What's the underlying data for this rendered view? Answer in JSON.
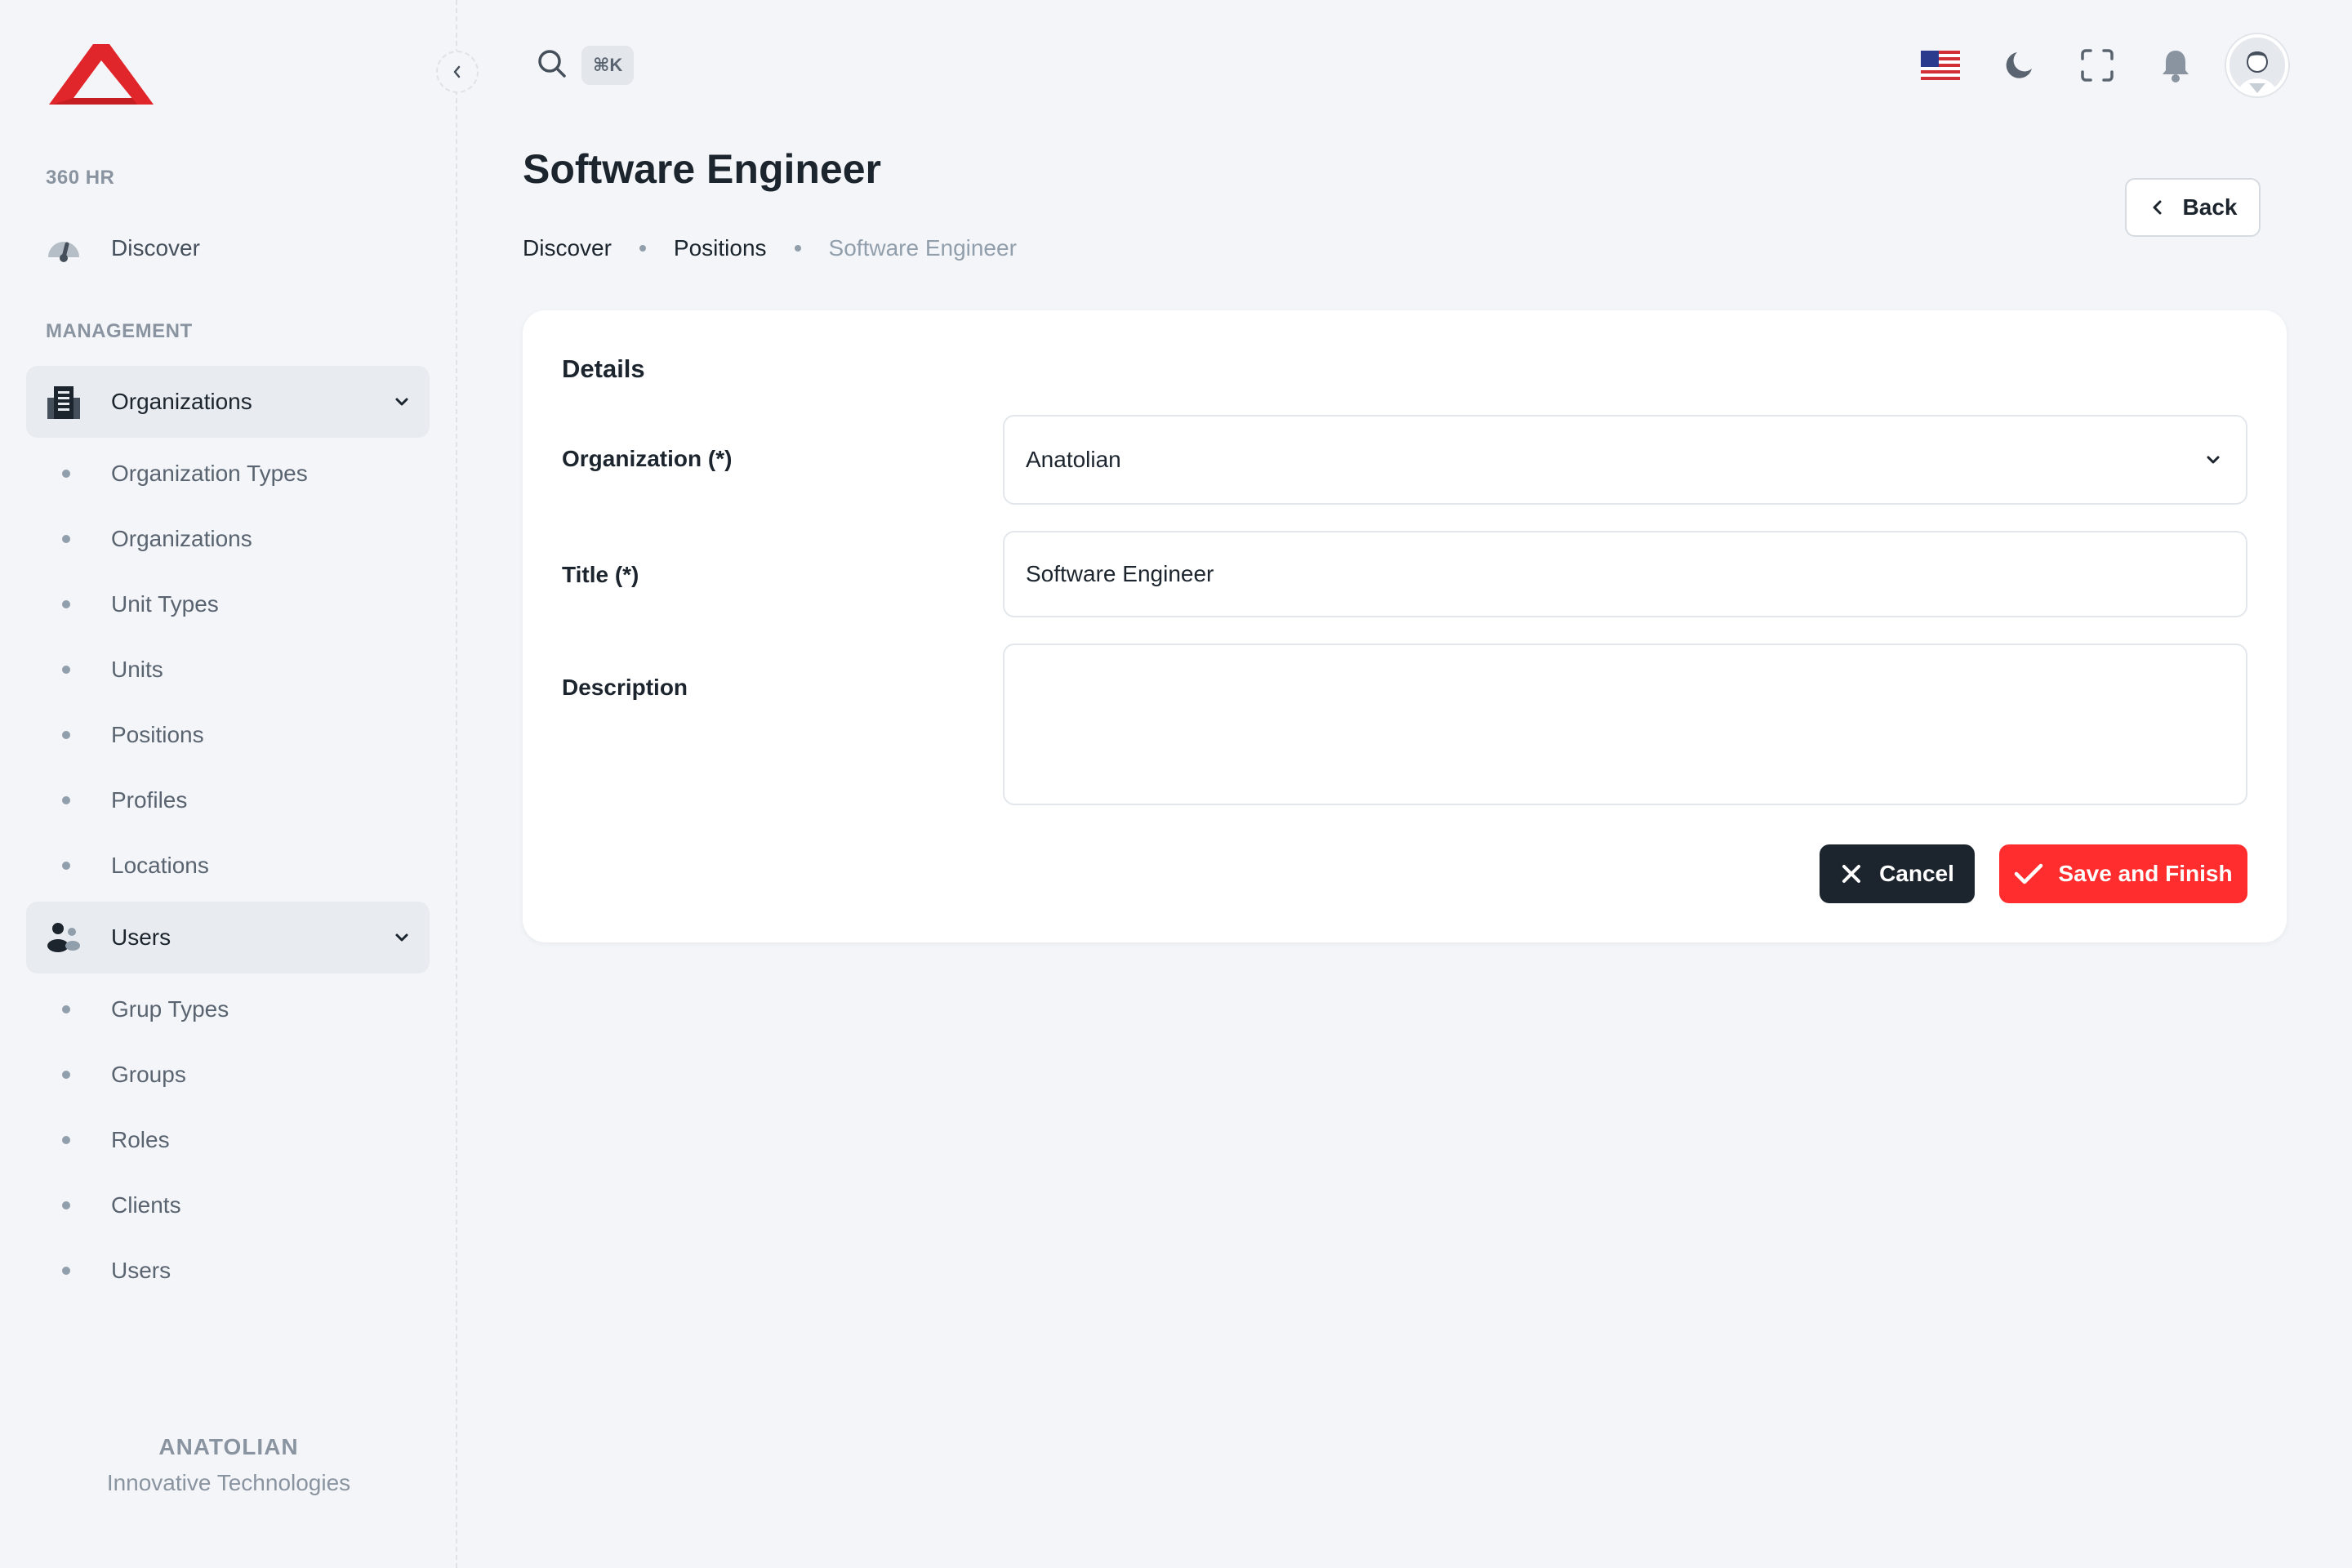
{
  "sidebar": {
    "section_general": "360 HR",
    "discover_label": "Discover",
    "section_management": "MANAGEMENT",
    "organizations_group": {
      "label": "Organizations",
      "items": [
        "Organization Types",
        "Organizations",
        "Unit Types",
        "Units",
        "Positions",
        "Profiles",
        "Locations"
      ]
    },
    "users_group": {
      "label": "Users",
      "items": [
        "Grup Types",
        "Groups",
        "Roles",
        "Clients",
        "Users"
      ]
    },
    "footer": {
      "company": "ANATOLIAN",
      "tagline": "Innovative Technologies"
    }
  },
  "header": {
    "search_shortcut": "⌘K",
    "icons": [
      "search-icon",
      "us-flag-icon",
      "moon-icon",
      "fullscreen-icon",
      "bell-icon",
      "avatar"
    ]
  },
  "page": {
    "title": "Software Engineer",
    "breadcrumb": [
      "Discover",
      "Positions",
      "Software Engineer"
    ],
    "back_label": "Back"
  },
  "form": {
    "section_title": "Details",
    "organization": {
      "label": "Organization (*)",
      "value": "Anatolian"
    },
    "title": {
      "label": "Title (*)",
      "value": "Software Engineer"
    },
    "description": {
      "label": "Description",
      "value": ""
    },
    "cancel_label": "Cancel",
    "save_label": "Save and Finish"
  },
  "colors": {
    "accent_red": "#ff2d2d",
    "dark": "#1c252e",
    "background": "#f3f5f8",
    "active_nav_bg": "#e8ebef"
  }
}
